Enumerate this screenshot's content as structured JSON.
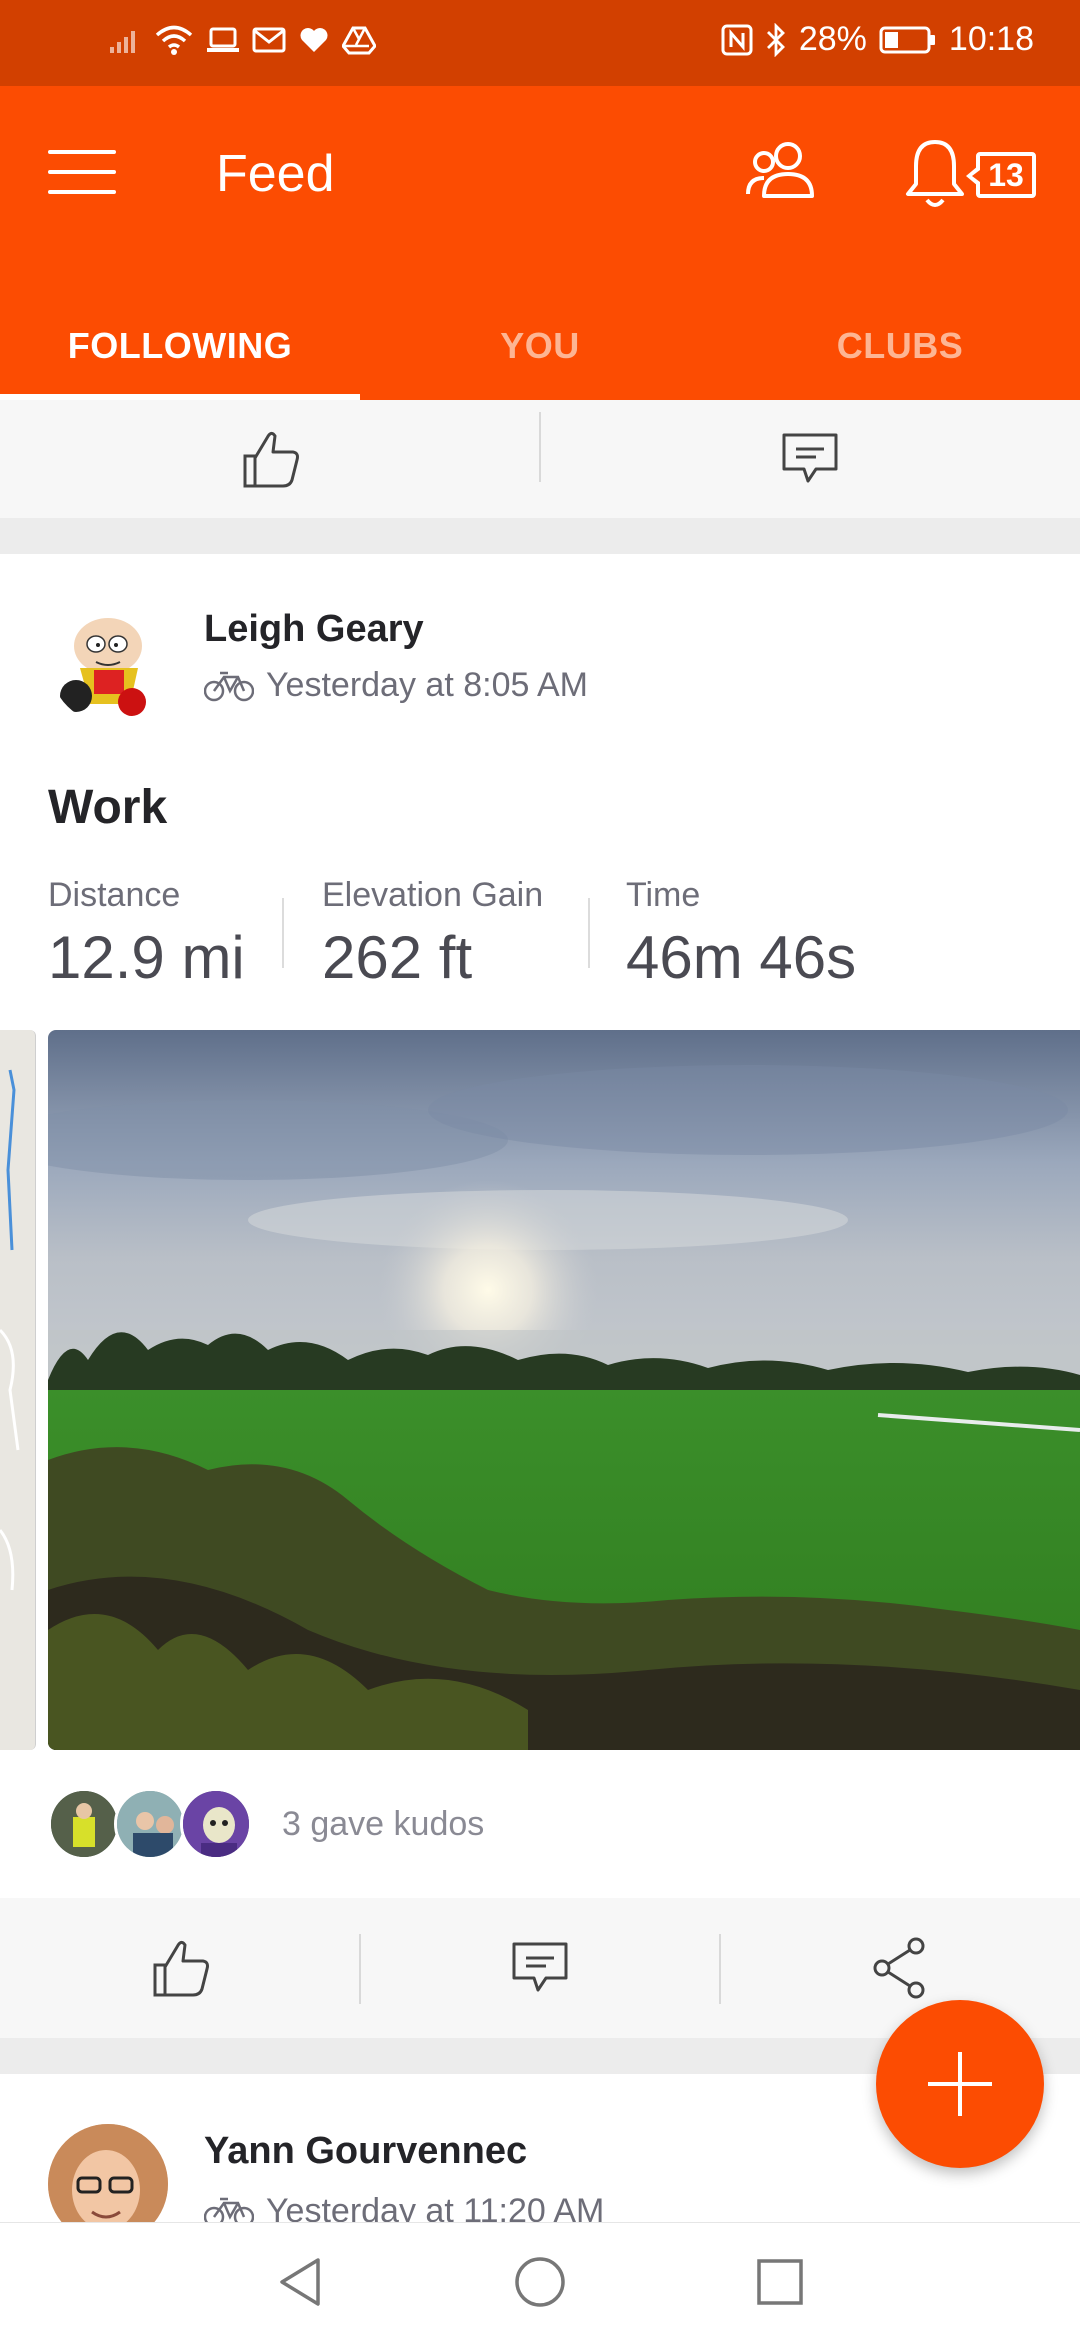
{
  "status_bar": {
    "battery_percent": "28%",
    "time": "10:18",
    "left_icons": [
      "signal-icon",
      "wifi-icon",
      "laptop-icon",
      "mail-icon",
      "heart-icon",
      "drive-icon"
    ],
    "right_icons": [
      "nfc-icon",
      "bluetooth-icon",
      "battery-icon"
    ]
  },
  "app_bar": {
    "title": "Feed",
    "notification_count": "13"
  },
  "tabs": [
    {
      "label": "FOLLOWING",
      "active": true
    },
    {
      "label": "YOU",
      "active": false
    },
    {
      "label": "CLUBS",
      "active": false
    }
  ],
  "activity": {
    "author": "Leigh Geary",
    "timestamp": "Yesterday at 8:05 AM",
    "sport_icon": "bike-icon",
    "title": "Work",
    "stats": [
      {
        "label": "Distance",
        "value": "12.9 mi"
      },
      {
        "label": "Elevation Gain",
        "value": "262 ft"
      },
      {
        "label": "Time",
        "value": "46m 46s"
      }
    ],
    "kudos_text": "3 gave kudos",
    "kudos_avatars": 3
  },
  "next_activity": {
    "author": "Yann Gourvennec",
    "timestamp": "Yesterday at 11:20 AM"
  },
  "colors": {
    "brand": "#fc4c02",
    "status_bar": "#d24000"
  }
}
